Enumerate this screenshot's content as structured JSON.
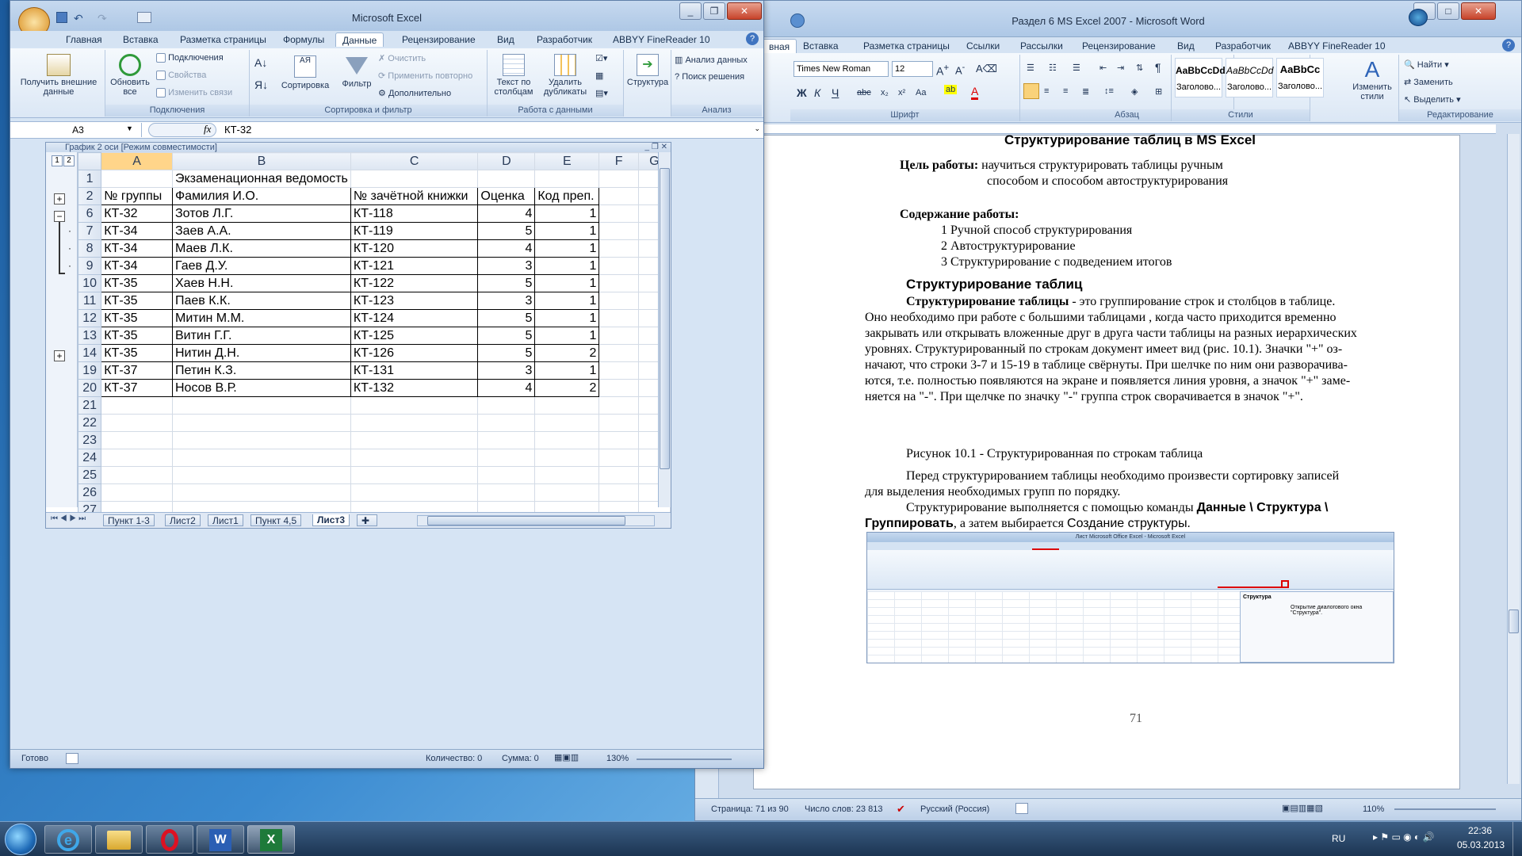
{
  "excel": {
    "title": "Microsoft Excel",
    "tabs": [
      "Главная",
      "Вставка",
      "Разметка страницы",
      "Формулы",
      "Данные",
      "Рецензирование",
      "Вид",
      "Разработчик",
      "ABBYY FineReader 10"
    ],
    "ribbon": {
      "get_external": "Получить внешние данные",
      "refresh_all": "Обновить все",
      "connections": "Подключения",
      "properties": "Свойства",
      "edit_links": "Изменить связи",
      "group_connections": "Подключения",
      "sort": "Сортировка",
      "filter": "Фильтр",
      "clear": "Очистить",
      "reapply": "Применить повторно",
      "advanced": "Дополнительно",
      "group_sort": "Сортировка и фильтр",
      "text_to_columns": "Текст по столбцам",
      "remove_duplicates": "Удалить дубликаты",
      "group_data_tools": "Работа с данными",
      "outline": "Структура",
      "data_analysis": "Анализ данных",
      "solver": "Поиск решения",
      "group_analysis": "Анализ"
    },
    "namebox": "A3",
    "formula": "КТ-32",
    "workbook_title": "График 2 оси  [Режим совместимости]",
    "outline_levels": [
      "1",
      "2"
    ],
    "columns": [
      "A",
      "B",
      "C",
      "D",
      "E",
      "F",
      "G"
    ],
    "rows": [
      {
        "num": "1",
        "cells": [
          "",
          "Экзаменационная ведомость",
          "",
          "",
          "",
          ""
        ],
        "mark": ""
      },
      {
        "num": "2",
        "cells": [
          "№ группы",
          "Фамилия И.О.",
          "№ зачётной книжки",
          "Оценка",
          "Код преп.",
          ""
        ],
        "mark": "+"
      },
      {
        "num": "6",
        "cells": [
          "КТ-32",
          "Зотов Л.Г.",
          "КТ-118",
          "4",
          "1",
          ""
        ],
        "mark": "−"
      },
      {
        "num": "7",
        "cells": [
          "КТ-34",
          "Заев А.А.",
          "КТ-119",
          "5",
          "1",
          ""
        ],
        "mark": "·"
      },
      {
        "num": "8",
        "cells": [
          "КТ-34",
          "Маев Л.К.",
          "КТ-120",
          "4",
          "1",
          ""
        ],
        "mark": "·"
      },
      {
        "num": "9",
        "cells": [
          "КТ-34",
          "Гаев Д.У.",
          "КТ-121",
          "3",
          "1",
          ""
        ],
        "mark": "·"
      },
      {
        "num": "10",
        "cells": [
          "КТ-35",
          "Хаев Н.Н.",
          "КТ-122",
          "5",
          "1",
          ""
        ],
        "mark": ""
      },
      {
        "num": "11",
        "cells": [
          "КТ-35",
          "Паев К.К.",
          "КТ-123",
          "3",
          "1",
          ""
        ],
        "mark": ""
      },
      {
        "num": "12",
        "cells": [
          "КТ-35",
          "Митин М.М.",
          "КТ-124",
          "5",
          "1",
          ""
        ],
        "mark": ""
      },
      {
        "num": "13",
        "cells": [
          "КТ-35",
          "Витин Г.Г.",
          "КТ-125",
          "5",
          "1",
          ""
        ],
        "mark": ""
      },
      {
        "num": "14",
        "cells": [
          "КТ-35",
          "Нитин Д.Н.",
          "КТ-126",
          "5",
          "2",
          ""
        ],
        "mark": "+"
      },
      {
        "num": "19",
        "cells": [
          "КТ-37",
          "Петин К.З.",
          "КТ-131",
          "3",
          "1",
          ""
        ],
        "mark": ""
      },
      {
        "num": "20",
        "cells": [
          "КТ-37",
          "Носов В.Р.",
          "КТ-132",
          "4",
          "2",
          ""
        ],
        "mark": ""
      },
      {
        "num": "21",
        "cells": [
          "",
          "",
          "",
          "",
          "",
          ""
        ],
        "mark": ""
      },
      {
        "num": "22",
        "cells": [
          "",
          "",
          "",
          "",
          "",
          ""
        ],
        "mark": ""
      },
      {
        "num": "23",
        "cells": [
          "",
          "",
          "",
          "",
          "",
          ""
        ],
        "mark": ""
      },
      {
        "num": "24",
        "cells": [
          "",
          "",
          "",
          "",
          "",
          ""
        ],
        "mark": ""
      },
      {
        "num": "25",
        "cells": [
          "",
          "",
          "",
          "",
          "",
          ""
        ],
        "mark": ""
      },
      {
        "num": "26",
        "cells": [
          "",
          "",
          "",
          "",
          "",
          ""
        ],
        "mark": ""
      },
      {
        "num": "27",
        "cells": [
          "",
          "",
          "",
          "",
          "",
          ""
        ],
        "mark": ""
      }
    ],
    "sheets": [
      "Пункт 1-3",
      "Лист2",
      "Лист1",
      "Пункт 4,5",
      "Лист3"
    ],
    "status_ready": "Готово",
    "status_count": "Количество: 0",
    "status_sum": "Сумма: 0",
    "zoom": "130%"
  },
  "word": {
    "title": "Раздел 6 MS Excel 2007 - Microsoft Word",
    "tabs": [
      "Вставка",
      "Разметка страницы",
      "Ссылки",
      "Рассылки",
      "Рецензирование",
      "Вид",
      "Разработчик",
      "ABBYY FineReader 10"
    ],
    "first_tab": "вная",
    "font": "Times New Roman",
    "size": "12",
    "styles": [
      {
        "sample": "AaBbCcDd",
        "name": "Заголово..."
      },
      {
        "sample": "AaBbCcDd",
        "name": "Заголово..."
      },
      {
        "sample": "AaBbCc",
        "name": "Заголово..."
      }
    ],
    "change_styles": "Изменить стили",
    "find": "Найти",
    "replace": "Заменить",
    "select": "Выделить",
    "group_font": "Шрифт",
    "group_paragraph": "Абзац",
    "group_styles": "Стили",
    "group_editing": "Редактирование",
    "status_page": "Страница: 71 из 90",
    "status_words": "Число слов: 23 813",
    "status_lang": "Русский (Россия)",
    "zoom": "110%",
    "doc": {
      "heading_top": "Структурирование таблиц в MS Excel",
      "goal_label": "Цель работы:",
      "goal_text_1": " научиться структурировать таблицы ручным",
      "goal_text_2": "способом и способом автоструктурирования",
      "contents_label": "Содержание работы:",
      "contents": [
        "1 Ручной способ структурирования",
        "2 Автоструктурирование",
        "3 Структурирование с подведением итогов"
      ],
      "section_title": "Структурирование таблиц",
      "p1_bold": "Структурирование таблицы",
      "p1_lines": [
        " -   это группирование строк и столбцов в таблице.",
        "Оно необходимо при работе с большими таблицами , когда часто приходится временно",
        "закрывать или открывать вложенные друг в друга части таблицы на разных иерархических",
        "уровнях. Структурированный по строкам документ имеет вид (рис. 10.1). Значки  \"+\" оз-",
        "начают, что строки 3-7 и 15-19 в таблице свёрнуты. При шелчке по ним они разворачива-",
        "ются, т.е. полностью появляются на экране и появляется линия уровня, а значок \"+\" заме-",
        "няется на \"-\".   При щелчке по значку \"-\"  группа строк сворачивается в значок \"+\"."
      ],
      "caption": "Рисунок 10.1 -  Структурированная по строкам таблица",
      "p2_lines": [
        "Перед структурированием таблицы необходимо произвести сортировку записей",
        "для выделения необходимых групп по порядку."
      ],
      "p3_a": "Структурирование выполняется с помощью команды ",
      "p3_b": "Данные \\ Структура \\",
      "p3_c": "Группировать",
      "p3_d": ", а затем выбирается ",
      "p3_e": "Создание структуры",
      "p3_f": ".",
      "page_number": "71",
      "embedded_title": "Лист Microsoft Office Excel - Microsoft Excel",
      "embedded_tooltip_title": "Структура",
      "embedded_tooltip_text": "Открытие диалогового окна \"Структура\"."
    }
  },
  "taskbar": {
    "lang": "RU",
    "time": "22:36",
    "date": "05.03.2013"
  }
}
